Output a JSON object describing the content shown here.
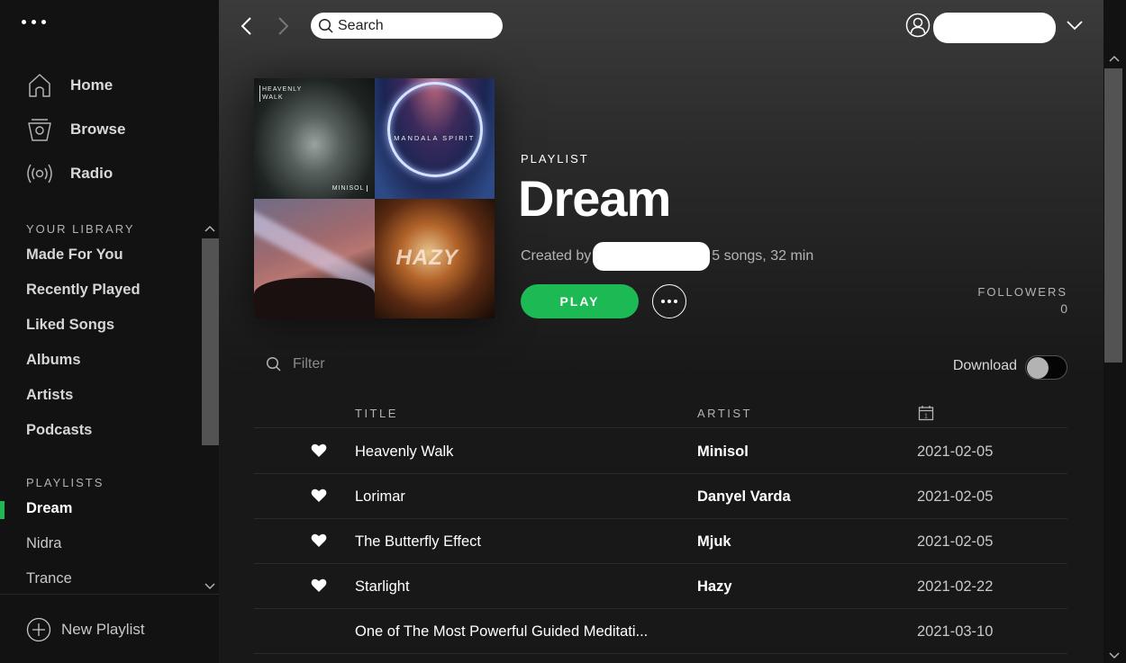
{
  "sidebar": {
    "menu_icon": "ellipsis-icon",
    "nav": [
      {
        "label": "Home",
        "icon": "home-icon"
      },
      {
        "label": "Browse",
        "icon": "browse-icon"
      },
      {
        "label": "Radio",
        "icon": "radio-icon"
      }
    ],
    "library_heading": "YOUR LIBRARY",
    "library": [
      "Made For You",
      "Recently Played",
      "Liked Songs",
      "Albums",
      "Artists",
      "Podcasts"
    ],
    "playlists_heading": "PLAYLISTS",
    "playlists": [
      "Dream",
      "Nidra",
      "Trance"
    ],
    "active_playlist": "Dream",
    "new_playlist": "New Playlist"
  },
  "topbar": {
    "search_placeholder": "Search",
    "user_name": "[redacted]"
  },
  "playlist": {
    "type_label": "PLAYLIST",
    "title": "Dream",
    "created_by_prefix": "Created by",
    "creator": "[redacted]",
    "summary": "5 songs, 32 min",
    "play_label": "PLAY",
    "followers_label": "FOLLOWERS",
    "followers_count": "0",
    "cover_tiles": [
      {
        "text_top": "HEAVENLY WALK",
        "text_bottom": "MINISOL"
      },
      {
        "text": "MANDALA SPIRIT"
      },
      {
        "text": ""
      },
      {
        "text": "HAZY"
      }
    ]
  },
  "controls": {
    "filter_placeholder": "Filter",
    "download_label": "Download",
    "download_enabled": false
  },
  "table": {
    "columns": {
      "title": "TITLE",
      "artist": "ARTIST",
      "date_icon": "calendar-icon"
    },
    "rows": [
      {
        "title": "Heavenly Walk",
        "artist": "Minisol",
        "date": "2021-02-05",
        "liked": true
      },
      {
        "title": "Lorimar",
        "artist": "Danyel Varda",
        "date": "2021-02-05",
        "liked": true
      },
      {
        "title": "The Butterfly Effect",
        "artist": "Mjuk",
        "date": "2021-02-05",
        "liked": true
      },
      {
        "title": "Starlight",
        "artist": "Hazy",
        "date": "2021-02-22",
        "liked": true
      },
      {
        "title": "One of The Most Powerful Guided Meditati...",
        "artist": "",
        "date": "2021-03-10",
        "liked": false
      }
    ]
  },
  "colors": {
    "accent": "#1db954",
    "sidebar_bg": "#121212",
    "main_bg": "#181818"
  }
}
